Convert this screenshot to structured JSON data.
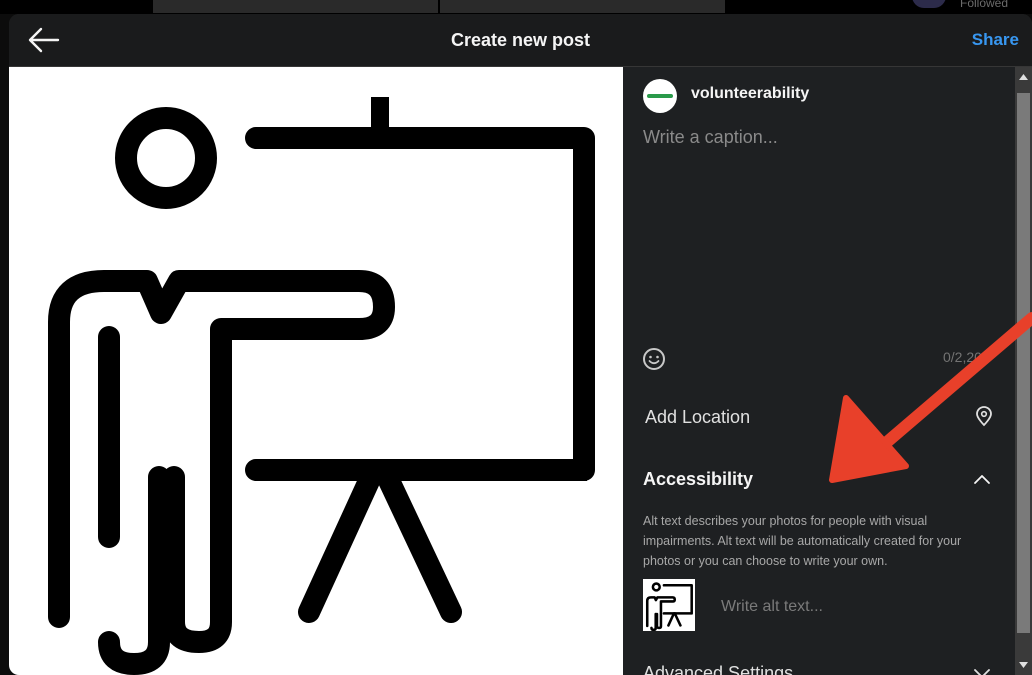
{
  "background": {
    "followed_text": "Followed"
  },
  "header": {
    "title": "Create new post",
    "share_label": "Share",
    "back_icon": "arrow-left-icon"
  },
  "post_image": {
    "description_icon": "presenter-whiteboard-icon"
  },
  "account": {
    "username": "volunteerability"
  },
  "caption": {
    "placeholder": "Write a caption...",
    "value": "",
    "char_count": "0/2,20"
  },
  "location": {
    "label": "Add Location",
    "icon": "location-pin-icon"
  },
  "accessibility": {
    "label": "Accessibility",
    "expanded": true,
    "description": "Alt text describes your photos for people with visual impairments. Alt text will be automatically created for your photos or you can choose to write your own.",
    "alt_placeholder": "Write alt text...",
    "alt_value": ""
  },
  "advanced": {
    "label": "Advanced Settings",
    "icon": "chevron-down-icon"
  },
  "colors": {
    "accent": "#3897f0",
    "annotation_arrow": "#e8402a",
    "panel_bg": "#1e2022",
    "header_bg": "#1a1b1c"
  }
}
